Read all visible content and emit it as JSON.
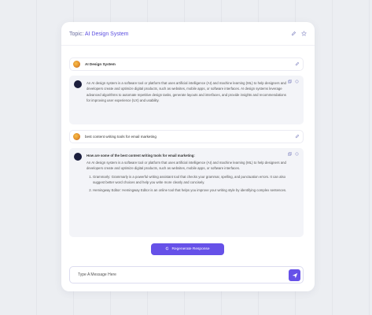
{
  "header": {
    "title_prefix": "Topic:",
    "topic_name": "AI Design System",
    "icons": [
      "edit-icon",
      "star-icon"
    ]
  },
  "conversation": [
    {
      "user": {
        "text": "AI Design System"
      },
      "ai": {
        "text": "An AI design system is a software tool or platform that uses artificial intelligence (AI) and machine learning (ML) to help designers and developers create and optimize digital products, such as websites, mobile apps, or software interfaces. AI design systems leverage advanced algorithms to automate repetitive design tasks, generate layouts and interfaces, and provide insights and recommendations for improving user experience (UX) and usability."
      }
    },
    {
      "user": {
        "text": "best content writing tools for email marketing"
      },
      "ai": {
        "question": "How are some of the best content writing tools for email marketing:",
        "text": "An AI design system is a software tool or platform that uses artificial intelligence (AI) and machine learning (ML) to help designers and developers create and optimize digital products, such as websites, mobile apps, or software interfaces.",
        "list": [
          "Grammarly: Grammarly is a powerful writing assistant tool that checks your grammar, spelling, and punctuation errors. It can also suggest better word choices and help you write more clearly and concisely.",
          "Hemingway Editor: Hemingway Editor is an online tool that helps you improve your writing style by identifying complex sentences."
        ]
      }
    }
  ],
  "regenerate_label": "Regenerate Response",
  "input": {
    "placeholder": "Type A Message Here",
    "value": ""
  },
  "colors": {
    "accent": "#6651e8",
    "topic": "#5b4ee0",
    "ai_bubble": "#f3f4f8"
  }
}
